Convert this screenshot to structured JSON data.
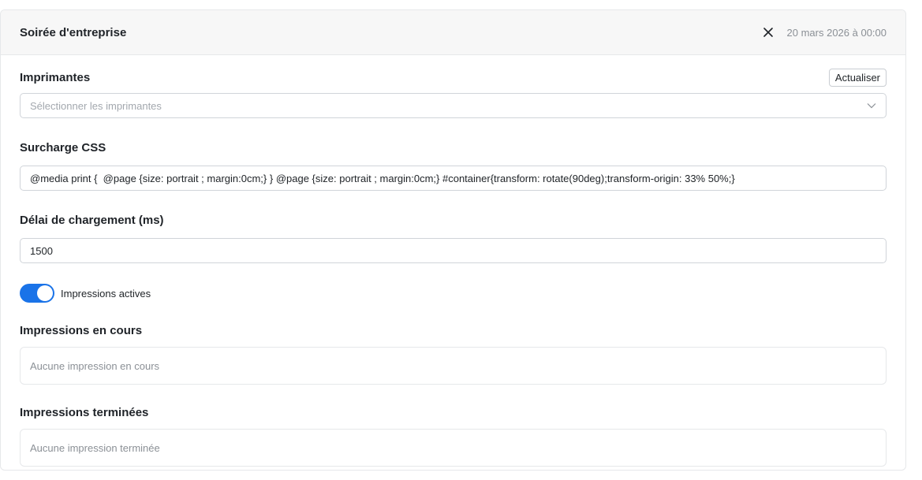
{
  "header": {
    "title": "Soirée d'entreprise",
    "date": "20 mars 2026 à 00:00",
    "close_icon": "close-icon"
  },
  "printers": {
    "label": "Imprimantes",
    "refresh_label": "Actualiser",
    "placeholder": "Sélectionner les imprimantes",
    "chevron_icon": "chevron-down-icon"
  },
  "css_override": {
    "label": "Surcharge CSS",
    "value": "@media print {  @page {size: portrait ; margin:0cm;} } @page {size: portrait ; margin:0cm;} #container{transform: rotate(90deg);transform-origin: 33% 50%;}"
  },
  "load_delay": {
    "label": "Délai de chargement (ms)",
    "value": "1500"
  },
  "active_toggle": {
    "label": "Impressions actives",
    "on": true,
    "color": "#1a73e8"
  },
  "in_progress": {
    "label": "Impressions en cours",
    "empty_text": "Aucune impression en cours"
  },
  "finished": {
    "label": "Impressions terminées",
    "empty_text": "Aucune impression terminée"
  }
}
